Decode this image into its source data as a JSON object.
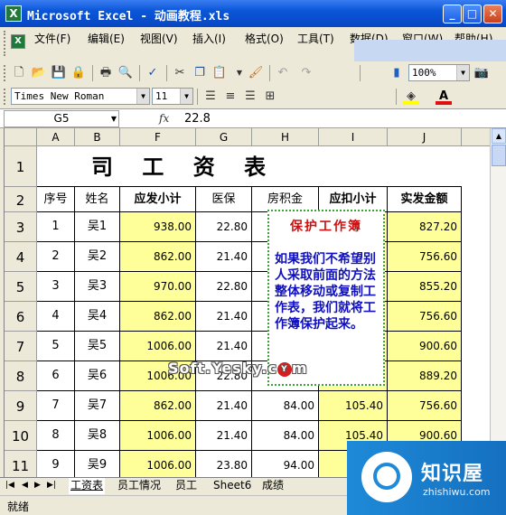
{
  "window": {
    "title": "Microsoft Excel - 动画教程.xls",
    "icon": "excel-icon",
    "minimize": "_",
    "maximize": "□",
    "close": "✕"
  },
  "menubar": {
    "items": [
      "文件(F)",
      "编辑(E)",
      "视图(V)",
      "插入(I)",
      "格式(O)",
      "工具(T)",
      "数据(D)",
      "窗口(W)",
      "帮助(H)"
    ]
  },
  "standard_toolbar": {
    "icons": [
      "new-icon",
      "open-icon",
      "save-icon",
      "permission-icon",
      "print-icon",
      "print-preview-icon",
      "spelling-icon",
      "cut-icon",
      "copy-icon",
      "paste-icon",
      "format-painter-icon",
      "undo-icon",
      "redo-icon",
      "chart-wizard-icon",
      "zoom-icon"
    ],
    "zoom": "100%"
  },
  "formatting_toolbar": {
    "font": "Times New Roman",
    "size": "11",
    "icons": [
      "align-left-icon",
      "align-center-icon",
      "align-right-icon",
      "merge-center-icon",
      "fill-color-icon",
      "font-color-icon"
    ]
  },
  "formula_bar": {
    "name_box": "G5",
    "fx": "fx",
    "value": "22.8"
  },
  "columns": [
    "A",
    "B",
    "F",
    "G",
    "H",
    "I",
    "J"
  ],
  "rows": [
    "1",
    "2",
    "3",
    "4",
    "5",
    "6",
    "7",
    "8",
    "9",
    "10",
    "11"
  ],
  "sheet_title": "司 工 资 表",
  "headers": [
    "序号",
    "姓名",
    "应发小计",
    "医保",
    "房积金",
    "应扣小计",
    "实发金额"
  ],
  "data_rows": [
    [
      "1",
      "吴1",
      "938.00",
      "22.80",
      "",
      "",
      "827.20"
    ],
    [
      "2",
      "吴2",
      "862.00",
      "21.40",
      "",
      "",
      "756.60"
    ],
    [
      "3",
      "吴3",
      "970.00",
      "22.80",
      "",
      "",
      "855.20"
    ],
    [
      "4",
      "吴4",
      "862.00",
      "21.40",
      "",
      "",
      "756.60"
    ],
    [
      "5",
      "吴5",
      "1006.00",
      "21.40",
      "",
      "",
      "900.60"
    ],
    [
      "6",
      "吴6",
      "1006.00",
      "22.80",
      "",
      "",
      "889.20"
    ],
    [
      "7",
      "吴7",
      "862.00",
      "21.40",
      "84.00",
      "105.40",
      "756.60"
    ],
    [
      "8",
      "吴8",
      "1006.00",
      "21.40",
      "84.00",
      "105.40",
      "900.60"
    ],
    [
      "9",
      "吴9",
      "1006.00",
      "23.80",
      "94.00",
      "",
      ""
    ]
  ],
  "note": {
    "title": "保护工作簿",
    "body": "如果我们不希望别人采取前面的方法整体移动或复制工作表，我们就将工作簿保护起来。"
  },
  "watermark": {
    "text": "Soft.Yesky.c",
    "badge": "m"
  },
  "sheet_tabs": [
    "工资表",
    "员工情况",
    "员工",
    "Sheet6",
    "成绩"
  ],
  "status": "就绪",
  "logo": {
    "name": "知识屋",
    "url": "zhishiwu.com"
  }
}
